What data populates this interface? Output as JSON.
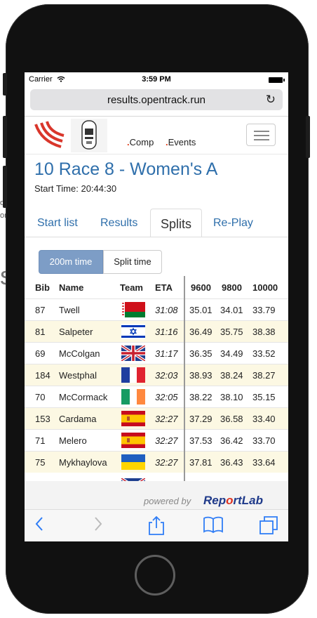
{
  "background": {
    "left_fragments": [
      "o",
      "or",
      "s"
    ]
  },
  "status_bar": {
    "carrier": "Carrier",
    "time": "3:59 PM"
  },
  "browser": {
    "url": "results.opentrack.run"
  },
  "nav": {
    "comp": "Comp",
    "events": "Events"
  },
  "header": {
    "title": "10 Race 8 - Women's A",
    "start_time": "Start Time: 20:44:30"
  },
  "tabs": [
    {
      "label": "Start list",
      "active": false
    },
    {
      "label": "Results",
      "active": false
    },
    {
      "label": "Splits",
      "active": true
    },
    {
      "label": "Re-Play",
      "active": false
    }
  ],
  "toggle": {
    "option_a": "200m time",
    "option_b": "Split time",
    "selected": "200m time"
  },
  "table": {
    "columns": [
      "Bib",
      "Name",
      "Team",
      "ETA",
      "9600",
      "9800",
      "10000"
    ],
    "rows": [
      {
        "bib": "87",
        "name": "Twell",
        "team": "Belarus",
        "eta": "31:08",
        "s9600": "35.01",
        "s9800": "34.01",
        "s10000": "33.79"
      },
      {
        "bib": "81",
        "name": "Salpeter",
        "team": "Israel",
        "eta": "31:16",
        "s9600": "36.49",
        "s9800": "35.75",
        "s10000": "38.38"
      },
      {
        "bib": "69",
        "name": "McColgan",
        "team": "Great Britain",
        "eta": "31:17",
        "s9600": "36.35",
        "s9800": "34.49",
        "s10000": "33.52"
      },
      {
        "bib": "184",
        "name": "Westphal",
        "team": "France",
        "eta": "32:03",
        "s9600": "38.93",
        "s9800": "38.24",
        "s10000": "38.27"
      },
      {
        "bib": "70",
        "name": "McCormack",
        "team": "Ireland",
        "eta": "32:05",
        "s9600": "38.22",
        "s9800": "38.10",
        "s10000": "35.15"
      },
      {
        "bib": "153",
        "name": "Cardama",
        "team": "Spain",
        "eta": "32:27",
        "s9600": "37.29",
        "s9800": "36.58",
        "s10000": "33.40"
      },
      {
        "bib": "71",
        "name": "Melero",
        "team": "Spain",
        "eta": "32:27",
        "s9600": "37.53",
        "s9800": "36.42",
        "s10000": "33.70"
      },
      {
        "bib": "75",
        "name": "Mykhaylova",
        "team": "Ukraine",
        "eta": "32:27",
        "s9600": "37.81",
        "s9800": "36.43",
        "s10000": "33.64"
      }
    ]
  },
  "footer": {
    "powered_by": "powered by",
    "brand_a": "Rep",
    "brand_b": "o",
    "brand_c": "rtLab"
  },
  "colors": {
    "link": "#2f6fab",
    "highlight_row": "#fcf8e3",
    "toggle_active": "#7d9dc6",
    "accent_dot": "#e0401d"
  }
}
